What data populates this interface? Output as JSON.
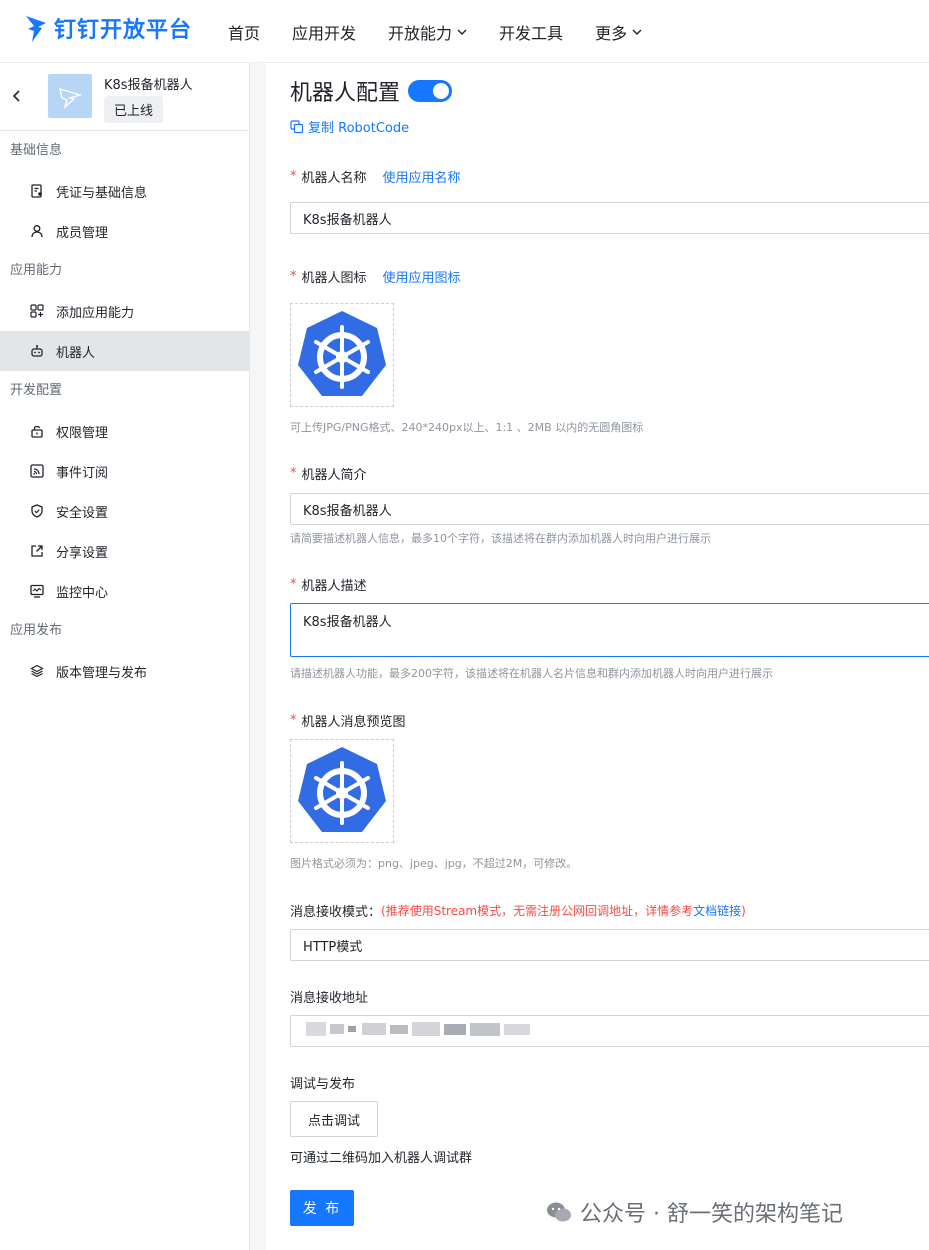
{
  "brand": {
    "name": "钉钉开放平台",
    "color": "#1677ff"
  },
  "nav": {
    "items": [
      {
        "label": "首页",
        "dropdown": false
      },
      {
        "label": "应用开发",
        "dropdown": false
      },
      {
        "label": "开放能力",
        "dropdown": true
      },
      {
        "label": "开发工具",
        "dropdown": false
      },
      {
        "label": "更多",
        "dropdown": true
      }
    ]
  },
  "sidebar": {
    "app_name": "K8s报备机器人",
    "app_status": "已上线",
    "groups": [
      {
        "title": "基础信息",
        "items": [
          {
            "label": "凭证与基础信息",
            "icon": "credential-icon"
          },
          {
            "label": "成员管理",
            "icon": "user-icon"
          }
        ]
      },
      {
        "title": "应用能力",
        "items": [
          {
            "label": "添加应用能力",
            "icon": "apps-add-icon"
          },
          {
            "label": "机器人",
            "icon": "robot-icon",
            "active": true
          }
        ]
      },
      {
        "title": "开发配置",
        "items": [
          {
            "label": "权限管理",
            "icon": "lock-icon"
          },
          {
            "label": "事件订阅",
            "icon": "rss-icon"
          },
          {
            "label": "安全设置",
            "icon": "shield-icon"
          },
          {
            "label": "分享设置",
            "icon": "share-icon"
          },
          {
            "label": "监控中心",
            "icon": "monitor-icon"
          }
        ]
      },
      {
        "title": "应用发布",
        "items": [
          {
            "label": "版本管理与发布",
            "icon": "layers-icon"
          }
        ]
      }
    ]
  },
  "main": {
    "title": "机器人配置",
    "toggle_on": true,
    "copy_label": "复制 RobotCode",
    "name_label": "机器人名称",
    "name_link": "使用应用名称",
    "name_value": "K8s报备机器人",
    "icon_label": "机器人图标",
    "icon_link": "使用应用图标",
    "icon_hint": "可上传JPG/PNG格式、240*240px以上、1:1 、2MB 以内的无圆角图标",
    "intro_label": "机器人简介",
    "intro_value": "K8s报备机器人",
    "intro_hint": "请简要描述机器人信息，最多10个字符，该描述将在群内添加机器人时向用户进行展示",
    "desc_label": "机器人描述",
    "desc_value": "K8s报备机器人",
    "desc_hint": "请描述机器人功能，最多200字符，该描述将在机器人名片信息和群内添加机器人时向用户进行展示",
    "preview_label": "机器人消息预览图",
    "preview_hint": "图片格式必须为：png、jpeg、jpg，不超过2M，可修改。",
    "mode_label": "消息接收模式：",
    "mode_warn": "(推荐使用Stream模式，无需注册公网回调地址，详情参考",
    "mode_doc_link": "文档链接",
    "mode_warn_end": ")",
    "mode_value": "HTTP模式",
    "url_label": "消息接收地址",
    "debug_label": "调试与发布",
    "debug_button": "点击调试",
    "debug_hint": "可通过二维码加入机器人调试群",
    "publish_button": "发 布"
  },
  "watermark": "公众号 · 舒一笑的架构笔记",
  "colors": {
    "accent": "#1677ff",
    "required": "#f54a45",
    "k8s": "#326ce5"
  }
}
